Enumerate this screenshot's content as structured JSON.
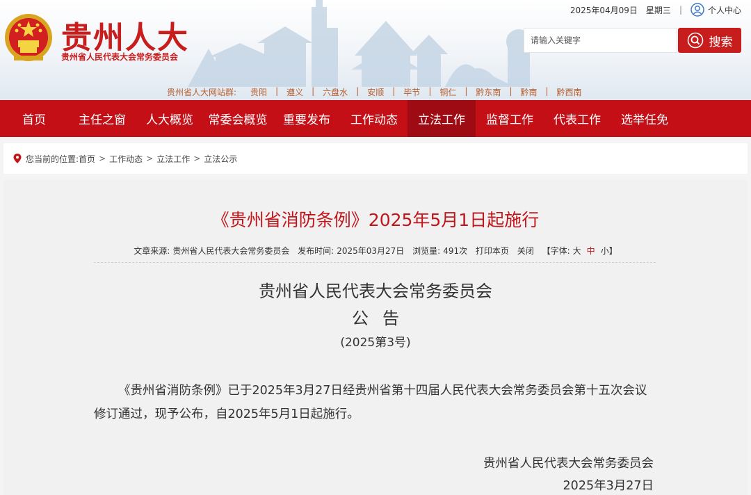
{
  "header": {
    "site_name": "贵州人大",
    "site_sub": "贵州省人民代表大会常务委员会",
    "date": "2025年04月09日",
    "weekday": "星期三",
    "separator": "|",
    "user_center": "个人中心",
    "search_placeholder": "请输入关键字",
    "search_label": "搜索",
    "sites_label": "贵州省人大网站群:",
    "sites": [
      "贵阳",
      "遵义",
      "六盘水",
      "安顺",
      "毕节",
      "铜仁",
      "黔东南",
      "黔南",
      "黔西南"
    ],
    "brand_color": "#c81d1d"
  },
  "nav": {
    "items": [
      "首页",
      "主任之窗",
      "人大概览",
      "常委会概览",
      "重要发布",
      "工作动态",
      "立法工作",
      "监督工作",
      "代表工作",
      "选举任免"
    ],
    "active": "立法工作",
    "bg_color": "#c50f17"
  },
  "breadcrumb": {
    "prefix": "您当前的位置:",
    "items": [
      "首页",
      "工作动态",
      "立法工作",
      "立法公示"
    ],
    "sep": ">"
  },
  "article": {
    "title": "《贵州省消防条例》2025年5月1日起施行",
    "meta": {
      "source_label": "文章来源:",
      "source": "贵州省人民代表大会常务委员会",
      "time_label": "发布时间:",
      "time": "2025年03月27日",
      "views_label": "浏览量:",
      "views": "491次",
      "print": "打印本页",
      "close": "关闭",
      "font_open": "【字体:",
      "font_large": "大",
      "font_mid": "中",
      "font_small": "小",
      "font_close": "】"
    },
    "org": "贵州省人民代表大会常务委员会",
    "notice": "公告",
    "number": "(2025第3号)",
    "body": "《贵州省消防条例》已于2025年3月27日经贵州省第十四届人民代表大会常务委员会第十五次会议修订通过，现予公布，自2025年5月1日起施行。",
    "sign_org": "贵州省人民代表大会常务委员会",
    "sign_date": "2025年3月27日"
  }
}
